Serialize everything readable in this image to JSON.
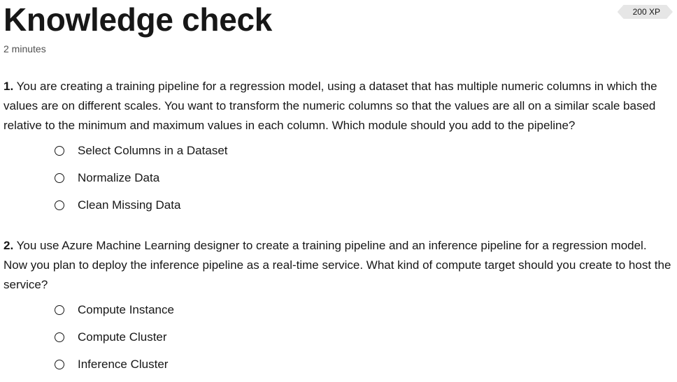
{
  "header": {
    "title": "Knowledge check",
    "duration": "2 minutes",
    "xp": "200 XP"
  },
  "questions": [
    {
      "number": "1.",
      "text": " You are creating a training pipeline for a regression model, using a dataset that has multiple numeric columns in which the values are on different scales. You want to transform the numeric columns so that the values are all on a similar scale based relative to the minimum and maximum values in each column. Which module should you add to the pipeline?",
      "options": [
        {
          "label": "Select Columns in a Dataset",
          "selected": false
        },
        {
          "label": "Normalize Data",
          "selected": false
        },
        {
          "label": "Clean Missing Data",
          "selected": false
        }
      ]
    },
    {
      "number": "2.",
      "text": " You use Azure Machine Learning designer to create a training pipeline and an inference pipeline for a regression model. Now you plan to deploy the inference pipeline as a real-time service. What kind of compute target should you create to host the service?",
      "options": [
        {
          "label": "Compute Instance",
          "selected": false
        },
        {
          "label": "Compute Cluster",
          "selected": false
        },
        {
          "label": "Inference Cluster",
          "selected": false
        }
      ]
    }
  ]
}
